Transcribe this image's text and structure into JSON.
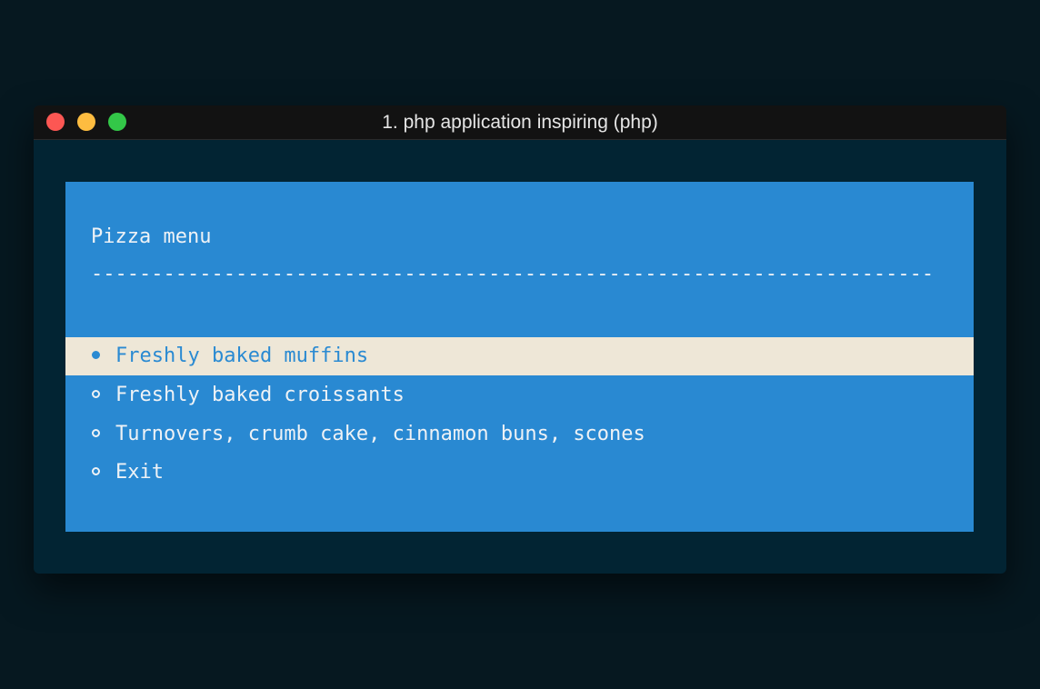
{
  "window": {
    "title": "1. php application inspiring (php)"
  },
  "menu": {
    "title": "Pizza menu",
    "divider": "----------------------------------------------------------------------",
    "items": [
      {
        "label": "Freshly baked muffins",
        "selected": true
      },
      {
        "label": "Freshly baked croissants",
        "selected": false
      },
      {
        "label": "Turnovers, crumb cake, cinnamon buns, scones",
        "selected": false
      },
      {
        "label": "Exit",
        "selected": false
      }
    ]
  },
  "colors": {
    "desktop_background": "#061820",
    "terminal_background": "#022433",
    "menu_background": "#2989d2",
    "selected_background": "#eee7d7",
    "text": "#eef2f6",
    "selected_text": "#2a8ad2"
  }
}
